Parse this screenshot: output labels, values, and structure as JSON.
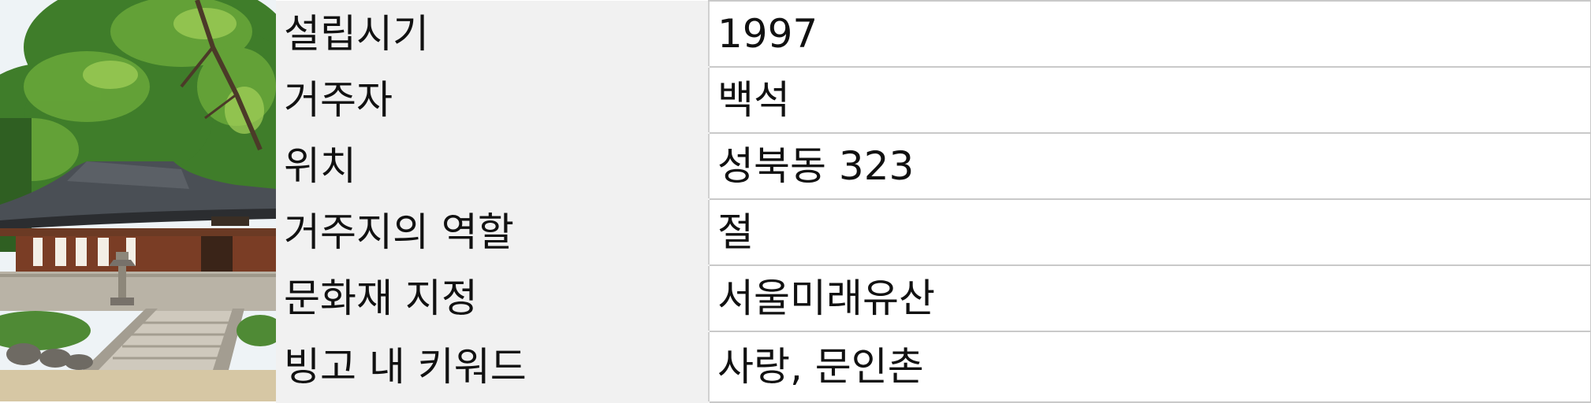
{
  "photo": {
    "description_icon": "hanok-pavilion-photo"
  },
  "info": {
    "rows": [
      {
        "label": "설립시기",
        "value": "1997"
      },
      {
        "label": "거주자",
        "value": "백석"
      },
      {
        "label": "위치",
        "value": "성북동 323"
      },
      {
        "label": "거주지의 역할",
        "value": "절"
      },
      {
        "label": "문화재 지정",
        "value": "서울미래유산"
      },
      {
        "label": "빙고 내 키워드",
        "value": "사랑, 문인촌"
      }
    ]
  }
}
